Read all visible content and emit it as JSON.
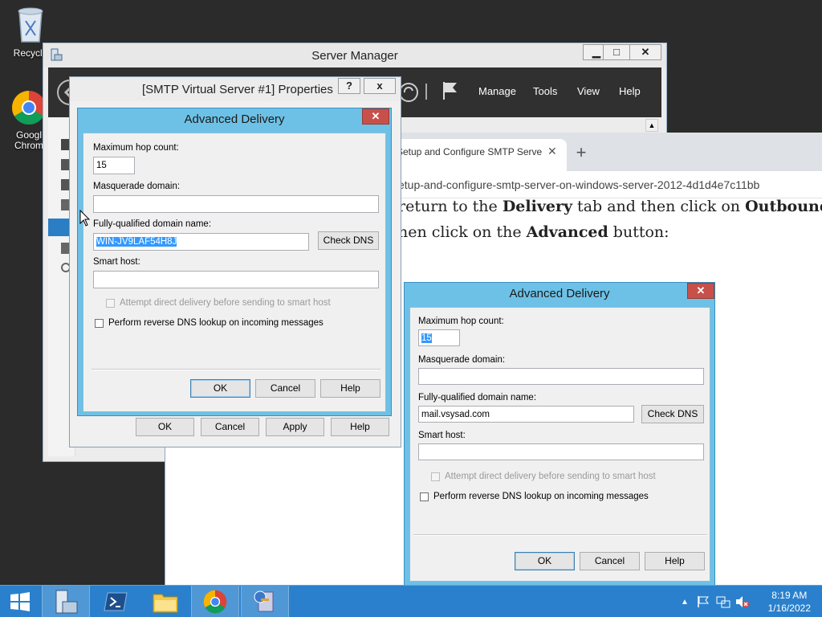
{
  "desktop": {
    "recycle_label": "Recycle",
    "chrome_label_1": "Googl",
    "chrome_label_2": "Chrom"
  },
  "server_manager": {
    "title": "Server Manager",
    "menus": [
      "Manage",
      "Tools",
      "View",
      "Help"
    ]
  },
  "browser": {
    "tab_title": "Setup and Configure SMTP Serve",
    "url_fragment": "etup-and-configure-smtp-server-on-windows-server-2012-4d1d4e7c11bb",
    "line1_pre": "return to the ",
    "line1_b1": "Delivery",
    "line1_mid": " tab and then click on ",
    "line1_b2": "Outbound",
    "line2_pre": "hen click on the ",
    "line2_b": "Advanced",
    "line2_post": " button:"
  },
  "smtp_props": {
    "title": "[SMTP Virtual Server #1] Properties",
    "help_btn": "?",
    "close_btn": "x",
    "buttons": {
      "ok": "OK",
      "cancel": "Cancel",
      "apply": "Apply",
      "help": "Help"
    }
  },
  "adv_delivery_main": {
    "title": "Advanced Delivery",
    "hop_label": "Maximum hop count:",
    "hop_value": "15",
    "masq_label": "Masquerade domain:",
    "masq_value": "",
    "fqdn_label": "Fully-qualified domain name:",
    "fqdn_value": "WIN-JV9LAF54H8J",
    "check_dns": "Check DNS",
    "smart_host_label": "Smart host:",
    "smart_host_value": "",
    "attempt_direct": "Attempt direct delivery before sending to smart host",
    "reverse_dns": "Perform reverse DNS lookup on incoming messages",
    "ok": "OK",
    "cancel": "Cancel",
    "help": "Help"
  },
  "adv_delivery_article": {
    "title": "Advanced Delivery",
    "hop_label": "Maximum hop count:",
    "hop_value": "15",
    "masq_label": "Masquerade domain:",
    "fqdn_label": "Fully-qualified domain name:",
    "fqdn_value": "mail.vsysad.com",
    "check_dns": "Check DNS",
    "smart_host_label": "Smart host:",
    "attempt_direct": "Attempt direct delivery before sending to smart host",
    "reverse_dns": "Perform reverse DNS lookup on incoming messages",
    "ok": "OK",
    "cancel": "Cancel",
    "help": "Help"
  },
  "taskbar": {
    "time": "8:19 AM",
    "date": "1/16/2022"
  },
  "colors": {
    "dialog_frame": "#6ec1e6",
    "taskbar": "#2a80cc",
    "close_red": "#c7514a",
    "selection": "#3399ff"
  }
}
